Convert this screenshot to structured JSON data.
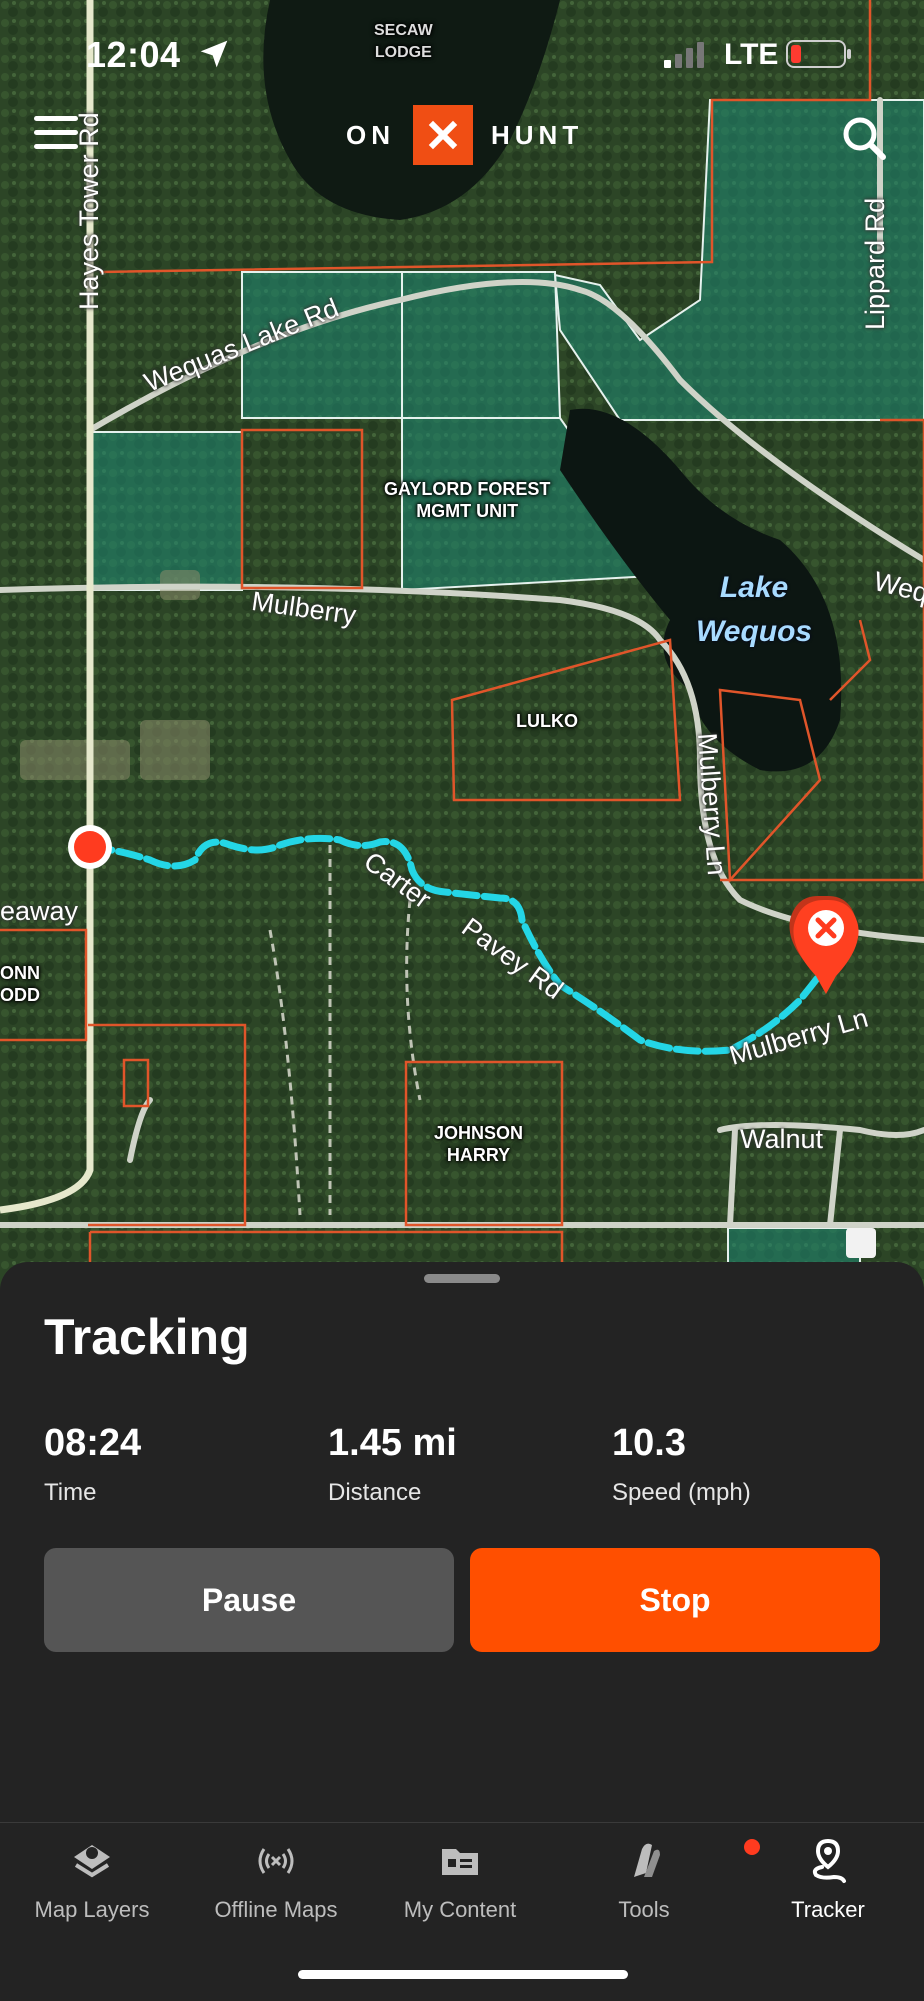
{
  "status_bar": {
    "time": "12:04",
    "carrier": "LTE"
  },
  "header": {
    "logo_left": "ON",
    "logo_right": "HUNT"
  },
  "map": {
    "labels": {
      "secaw": "SECAW\nLODGE",
      "gaylord": "GAYLORD FOREST\nMGMT UNIT",
      "lulko": "LULKO",
      "johnson": "JOHNSON\nHARRY",
      "donn": "ONN\nODD"
    },
    "roads": {
      "hayes": "Hayes Tower Rd",
      "wequas": "Wequas Lake Rd",
      "lippard": "Lippard Rd",
      "mulberry_w": "Mulberry",
      "mulberry_n": "Mulberry Ln",
      "mulberry_e": "Mulberry Ln",
      "carter": "Carter",
      "pavey": "Pavey Rd",
      "walnut": "Walnut",
      "eaway": "eaway",
      "weq": "Weq"
    },
    "lake": "Lake\nWequos"
  },
  "tracking": {
    "title": "Tracking",
    "stats": [
      {
        "value": "08:24",
        "label": "Time"
      },
      {
        "value": "1.45 mi",
        "label": "Distance"
      },
      {
        "value": "10.3",
        "label": "Speed (mph)"
      }
    ],
    "pause_label": "Pause",
    "stop_label": "Stop"
  },
  "tabs": [
    {
      "label": "Map Layers",
      "icon": "layers-icon"
    },
    {
      "label": "Offline Maps",
      "icon": "offline-signal-icon"
    },
    {
      "label": "My Content",
      "icon": "folder-icon"
    },
    {
      "label": "Tools",
      "icon": "tools-icon"
    },
    {
      "label": "Tracker",
      "icon": "tracker-icon",
      "active": true
    }
  ],
  "colors": {
    "accent": "#ff4f00",
    "track": "#24d6e6",
    "boundary": "#e0552a",
    "public_land": "#1f8a74"
  }
}
